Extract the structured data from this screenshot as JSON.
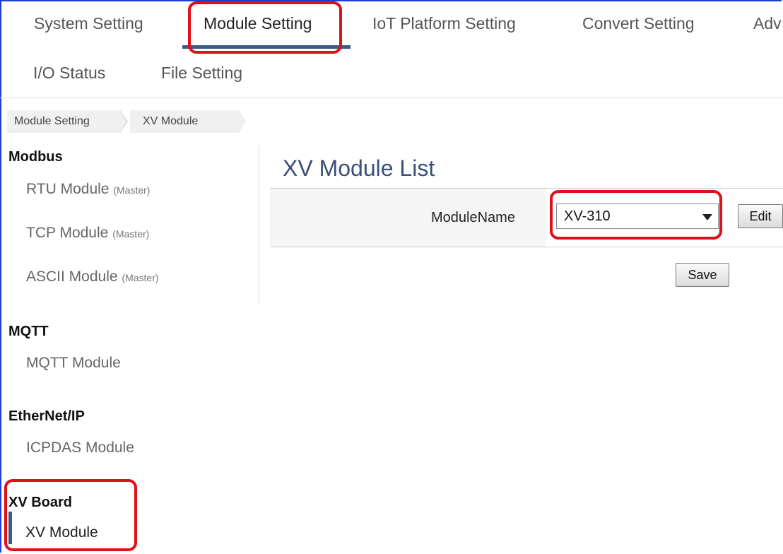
{
  "top_nav": {
    "tabs": [
      "System Setting",
      "Module Setting",
      "IoT Platform Setting",
      "Convert Setting",
      "Adv"
    ],
    "row2": [
      "I/O Status",
      "File Setting"
    ]
  },
  "breadcrumb": [
    "Module Setting",
    "XV Module"
  ],
  "sidebar": {
    "modbus": {
      "title": "Modbus",
      "items": [
        {
          "label": "RTU Module",
          "sub": "(Master)"
        },
        {
          "label": "TCP Module",
          "sub": "(Master)"
        },
        {
          "label": "ASCII Module",
          "sub": "(Master)"
        }
      ]
    },
    "mqtt": {
      "title": "MQTT",
      "items": [
        {
          "label": "MQTT Module"
        }
      ]
    },
    "ethernetip": {
      "title": "EtherNet/IP",
      "items": [
        {
          "label": "ICPDAS Module"
        }
      ]
    },
    "xv": {
      "title": "XV Board",
      "items": [
        {
          "label": "XV Module"
        }
      ]
    }
  },
  "main": {
    "title": "XV Module List",
    "form": {
      "label": "ModuleName",
      "selected": "XV-310",
      "edit_label": "Edit"
    },
    "save_label": "Save"
  },
  "colors": {
    "accent": "#3c5a8a",
    "highlight": "#e0101a",
    "title": "#3a4f78"
  }
}
